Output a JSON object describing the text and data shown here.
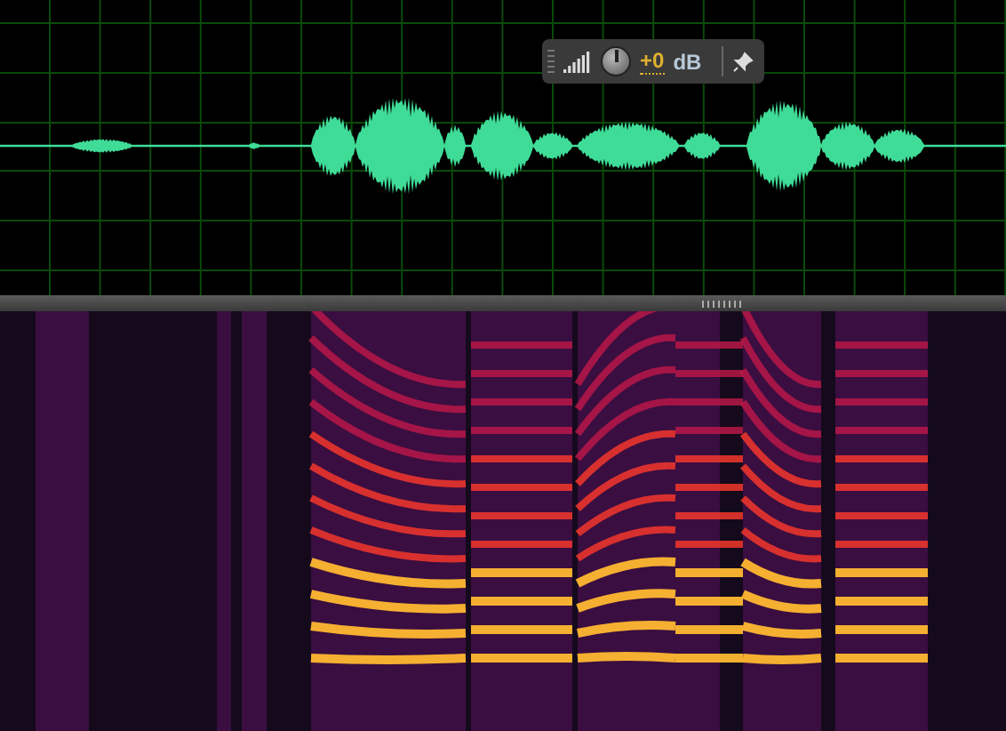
{
  "hud": {
    "gain": "+0",
    "unit": "dB"
  }
}
